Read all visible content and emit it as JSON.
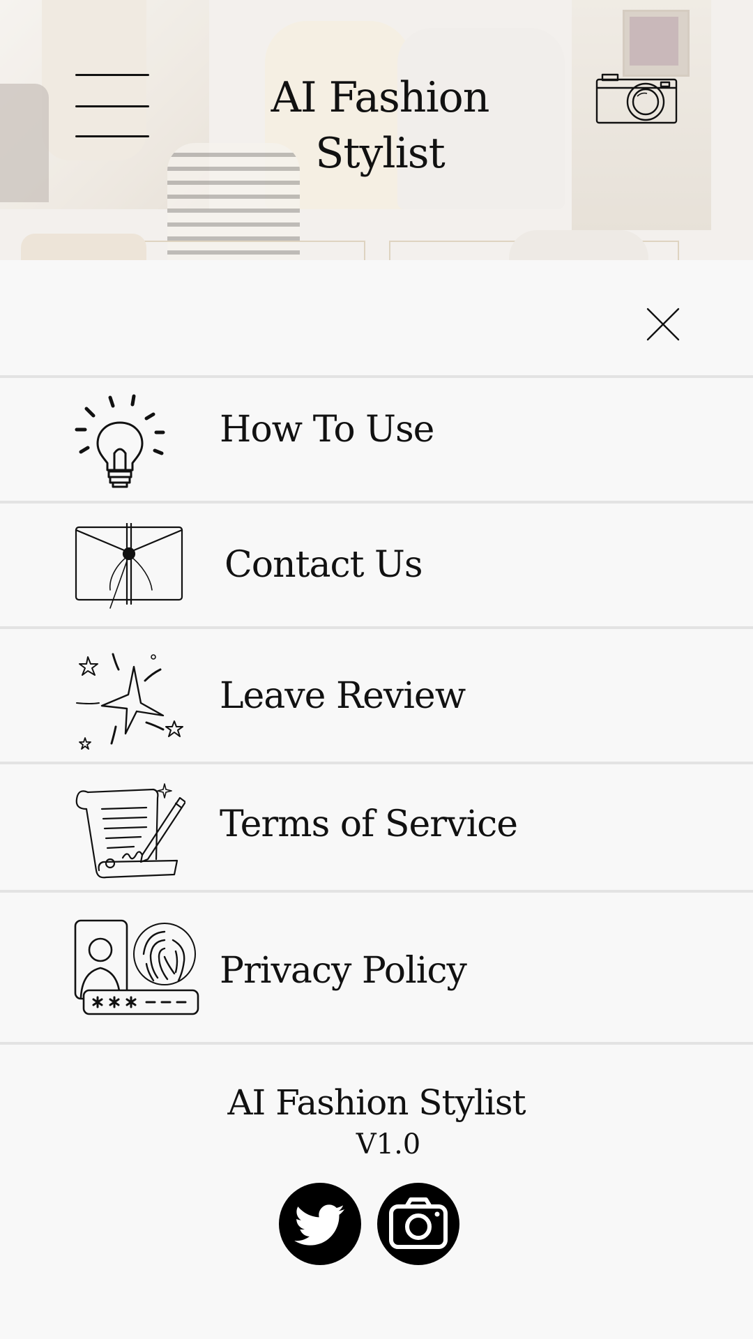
{
  "header": {
    "title": "AI Fashion Stylist",
    "menu_icon": "hamburger-menu-icon",
    "camera_icon": "camera-icon",
    "background": "faded knitwear clothing collage"
  },
  "menu": {
    "close_icon": "close-icon",
    "items": [
      {
        "label": "How To Use",
        "icon": "lightbulb-icon"
      },
      {
        "label": "Contact Us",
        "icon": "envelope-icon"
      },
      {
        "label": "Leave Review",
        "icon": "sparkle-star-icon"
      },
      {
        "label": "Terms of Service",
        "icon": "scroll-contract-icon"
      },
      {
        "label": "Privacy Policy",
        "icon": "privacy-id-fingerprint-icon"
      }
    ]
  },
  "footer": {
    "app_name": "AI Fashion Stylist",
    "version": "V1.0",
    "social": [
      {
        "icon": "twitter-icon"
      },
      {
        "icon": "instagram-icon"
      }
    ]
  },
  "colors": {
    "panel_background": "#f8f8f8",
    "divider": "#e3e3e3",
    "text": "#111111",
    "social_background": "#000000"
  }
}
